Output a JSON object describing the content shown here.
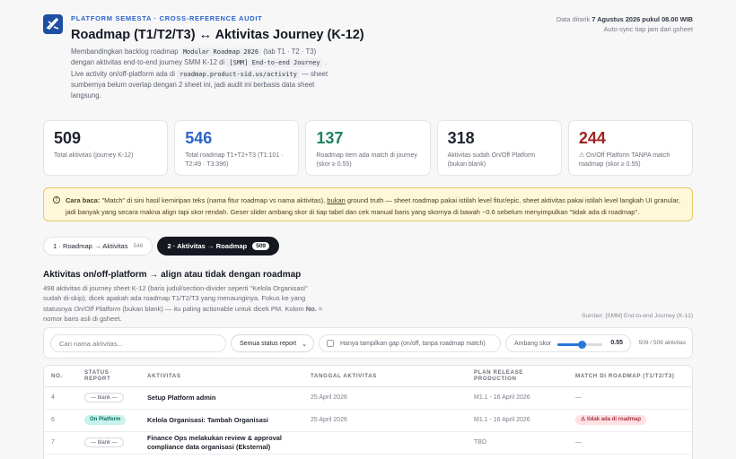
{
  "header": {
    "eyebrow": "PLATFORM SEMESTA · CROSS-REFERENCE AUDIT",
    "title": "Roadmap (T1/T2/T3) ↔ Aktivitas Journey (K-12)",
    "description": {
      "p1": "Membandingkan backlog roadmap",
      "code1": "Modular Roadmap 2026",
      "p2": "(tab T1 · T2 · T3) dengan aktivitas end-to-end journey SMM K-12 di",
      "code2": "[SMM] End-to-end Journey",
      "p3": ". Live activity on/off-platform ada di",
      "code3": "roadmap.product-sid.us/activity",
      "p4": "— sheet sumbernya belum overlap dengan 2 sheet ini, jadi audit ini berbasis data sheet langsung."
    },
    "meta_prefix": "Data ditarik",
    "meta_date": "7 Agustus 2026 pukul 08.00 WIB",
    "meta_line2": "Auto-sync tiap jam dari gsheet"
  },
  "stats": [
    {
      "value": "509",
      "caption": "Total aktivitas (journey K-12)"
    },
    {
      "value": "546",
      "caption": "Total roadmap T1+T2+T3 (T1:101 · T2:49 · T3:396)"
    },
    {
      "value": "137",
      "caption": "Roadmap item ada match di journey (skor ≥ 0.55)"
    },
    {
      "value": "318",
      "caption": "Aktivitas sudah On/Off Platform (bukan blank)"
    },
    {
      "value": "244",
      "caption": "⚠ On/Off Platform TANPA match roadmap (skor ≥ 0.55)"
    }
  ],
  "colors": {
    "accent": "#2c63c8",
    "green": "#1f8162",
    "red": "#9f2320",
    "warning_bg": "#fff7d9"
  },
  "warning": {
    "label": "Cara baca:",
    "t1": "\"Match\" di sini hasil kemiripan teks (nama fitur roadmap vs nama aktivitas),",
    "link": "bukan",
    "t2": "ground truth — sheet roadmap pakai istilah level fitur/epic, sheet aktivitas pakai istilah level langkah UI granular, jadi banyak yang secara makna align tapi skor rendah. Geser slider ambang skor di tiap tabel dan cek manual baris yang skornya di bawah ~0.6 sebelum menyimpulkan \"tidak ada di roadmap\"."
  },
  "tabs": [
    {
      "label": "1 · Roadmap → Aktivitas",
      "count": "546"
    },
    {
      "label": "2 · Aktivitas → Roadmap",
      "count": "509"
    }
  ],
  "section": {
    "title": "Aktivitas on/off-platform → align atau tidak dengan roadmap",
    "d1": "498 aktivitas di journey sheet K-12 (baris judul/section-divider seperti \"Kelola Organisasi\" sudah di-skip), dicek apakah ada roadmap T1/T2/T3 yang menaunginya. Fokus ke yang statusnya",
    "em": "On/Off Platform",
    "d2": "(bukan blank) — itu paling actionable untuk dicek PM. Kolom",
    "bold": "No.",
    "d3": "= nomor baris asli di gsheet.",
    "source": "Sumber: [SMM] End-to-end Journey (K-12)"
  },
  "filters": {
    "search_placeholder": "Cari nama aktivitas...",
    "status_value": "Semua status report",
    "gap_label": "Hanya tampilkan gap (on/off, tanpa roadmap match)",
    "threshold_label": "Ambang skor",
    "threshold_value": "0.55",
    "threshold_fraction": 0.55,
    "count": "509 / 509 aktivitas"
  },
  "table": {
    "headers": [
      "NO.",
      "STATUS REPORT",
      "AKTIVITAS",
      "TANGGAL AKTIVITAS",
      "PLAN RELEASE PRODUCTION",
      "MATCH DI ROADMAP (T1/T2/T3)"
    ],
    "rows": [
      {
        "no": "4",
        "status": "— blank —",
        "activity": "Setup Platform admin",
        "date": "25 April 2026",
        "plan": "M1.1 - 16 April 2026",
        "match": "—"
      },
      {
        "no": "6",
        "status": "On Platform",
        "activity": "Kelola Organisasi: Tambah Organisasi",
        "date": "25 April 2026",
        "plan": "M1.1 - 16 April 2026",
        "match": "tidak ada di roadmap"
      },
      {
        "no": "7",
        "status": "— blank —",
        "activity": "Finance Ops melakukan review & approval compliance data organisasi (Eksternal)",
        "date": "",
        "plan": "TBD",
        "match": "—"
      }
    ]
  }
}
